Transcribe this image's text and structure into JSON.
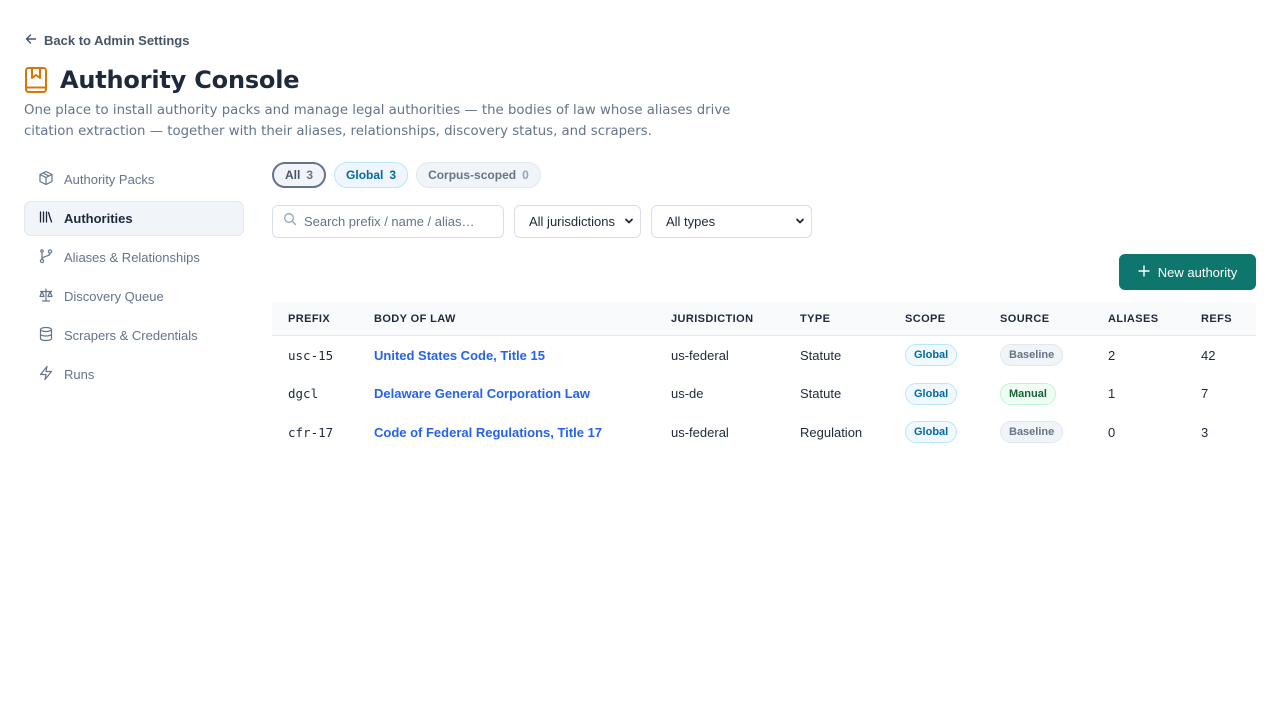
{
  "back_link": {
    "label": "Back to Admin Settings",
    "icon": "arrow-left-icon"
  },
  "page": {
    "title": "Authority Console",
    "title_icon": "book-bookmark-icon",
    "accent_color": "#d97706",
    "description": "One place to install authority packs and manage legal authorities — the bodies of law whose aliases drive citation extraction — together with their aliases, relationships, discovery status, and scrapers."
  },
  "sidebar": {
    "items": [
      {
        "label": "Authority Packs",
        "icon": "package-icon",
        "active": false
      },
      {
        "label": "Authorities",
        "icon": "library-icon",
        "active": true
      },
      {
        "label": "Aliases & Relationships",
        "icon": "git-branch-icon",
        "active": false
      },
      {
        "label": "Discovery Queue",
        "icon": "scale-icon",
        "active": false
      },
      {
        "label": "Scrapers & Credentials",
        "icon": "database-icon",
        "active": false
      },
      {
        "label": "Runs",
        "icon": "zap-icon",
        "active": false
      }
    ]
  },
  "filters": {
    "chips": [
      {
        "label": "All",
        "count": "3",
        "selected": true
      },
      {
        "label": "Global",
        "count": "3",
        "selected": false
      },
      {
        "label": "Corpus-scoped",
        "count": "0",
        "selected": false
      }
    ],
    "search_placeholder": "Search prefix / name / alias…",
    "jurisdiction_select": "All jurisdictions",
    "type_select": "All types"
  },
  "actions": {
    "new_authority_label": "New authority",
    "button_color": "#0f766e"
  },
  "table": {
    "headers": [
      "PREFIX",
      "BODY OF LAW",
      "JURISDICTION",
      "TYPE",
      "SCOPE",
      "SOURCE",
      "ALIASES",
      "REFS"
    ],
    "rows": [
      {
        "prefix": "usc-15",
        "body": "United States Code, Title 15",
        "jurisdiction": "us-federal",
        "type": "Statute",
        "scope": "Global",
        "source": "Baseline",
        "aliases": "2",
        "refs": "42"
      },
      {
        "prefix": "dgcl",
        "body": "Delaware General Corporation Law",
        "jurisdiction": "us-de",
        "type": "Statute",
        "scope": "Global",
        "source": "Manual",
        "aliases": "1",
        "refs": "7"
      },
      {
        "prefix": "cfr-17",
        "body": "Code of Federal Regulations, Title 17",
        "jurisdiction": "us-federal",
        "type": "Regulation",
        "scope": "Global",
        "source": "Baseline",
        "aliases": "0",
        "refs": "3"
      }
    ]
  }
}
